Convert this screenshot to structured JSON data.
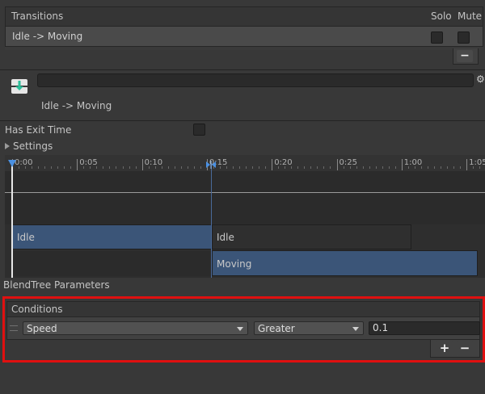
{
  "transitions": {
    "header": "Transitions",
    "solo_label": "Solo",
    "mute_label": "Mute",
    "item": "Idle -> Moving",
    "remove_label": "−"
  },
  "transition_detail": {
    "name_field": "",
    "title": "Idle -> Moving"
  },
  "has_exit_time_label": "Has Exit Time",
  "settings_label": "Settings",
  "timeline": {
    "labels": [
      "0:00",
      "0:05",
      "0:10",
      "0:15",
      "0:20",
      "0:25",
      "1:00",
      "1:05"
    ],
    "clips": {
      "source_top": "Idle",
      "source_bottom": "Idle",
      "destination": "Moving"
    }
  },
  "blendtree_label": "BlendTree Parameters",
  "conditions": {
    "header": "Conditions",
    "parameter": "Speed",
    "operator": "Greater",
    "value": "0.1",
    "add_label": "+",
    "remove_label": "−"
  },
  "colors": {
    "highlight_border": "#e01010",
    "clip_blue": "#3b5578",
    "clip_grey": "#2f2f2f"
  }
}
